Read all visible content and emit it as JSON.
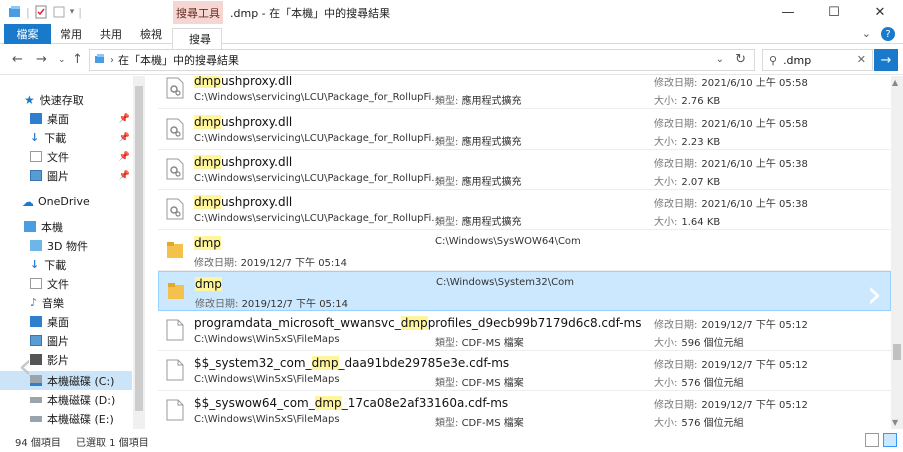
{
  "title_bar": {
    "context_tab": "搜尋工具",
    "title": ".dmp - 在「本機」中的搜尋結果"
  },
  "ribbon": {
    "tabs": [
      "檔案",
      "常用",
      "共用",
      "檢視",
      "搜尋"
    ]
  },
  "address": {
    "path": "在「本機」中的搜尋結果",
    "search_value": ".dmp"
  },
  "nav": {
    "quick_access": "快速存取",
    "quick_items": [
      "桌面",
      "下載",
      "文件",
      "圖片"
    ],
    "onedrive": "OneDrive",
    "this_pc": "本機",
    "pc_items": [
      "3D 物件",
      "下載",
      "文件",
      "音樂",
      "桌面",
      "圖片",
      "影片",
      "本機磁碟 (C:)",
      "本機磁碟 (D:)",
      "本機磁碟 (E:)"
    ]
  },
  "files": [
    {
      "kind": "dll",
      "pre": "",
      "hl": "dmp",
      "post": "ushproxy.dll",
      "path": "C:\\Windows\\servicing\\LCU\\Package_for_RollupFi...",
      "type_label": "類型:",
      "type": "應用程式擴充",
      "mod_label": "修改日期:",
      "mod": "2021/6/10 上午 05:58",
      "size_label": "大小:",
      "size": "2.76 KB"
    },
    {
      "kind": "dll",
      "pre": "",
      "hl": "dmp",
      "post": "ushproxy.dll",
      "path": "C:\\Windows\\servicing\\LCU\\Package_for_RollupFi...",
      "type_label": "類型:",
      "type": "應用程式擴充",
      "mod_label": "修改日期:",
      "mod": "2021/6/10 上午 05:58",
      "size_label": "大小:",
      "size": "2.23 KB"
    },
    {
      "kind": "dll",
      "pre": "",
      "hl": "dmp",
      "post": "ushproxy.dll",
      "path": "C:\\Windows\\servicing\\LCU\\Package_for_RollupFi...",
      "type_label": "類型:",
      "type": "應用程式擴充",
      "mod_label": "修改日期:",
      "mod": "2021/6/10 上午 05:38",
      "size_label": "大小:",
      "size": "2.07 KB"
    },
    {
      "kind": "dll",
      "pre": "",
      "hl": "dmp",
      "post": "ushproxy.dll",
      "path": "C:\\Windows\\servicing\\LCU\\Package_for_RollupFi...",
      "type_label": "類型:",
      "type": "應用程式擴充",
      "mod_label": "修改日期:",
      "mod": "2021/6/10 上午 05:38",
      "size_label": "大小:",
      "size": "1.64 KB"
    },
    {
      "kind": "folder",
      "pre": "",
      "hl": "dmp",
      "post": "",
      "location": "C:\\Windows\\SysWOW64\\Com",
      "mod_label": "修改日期:",
      "mod": "2019/12/7 下午 05:14"
    },
    {
      "kind": "folder",
      "pre": "",
      "hl": "dmp",
      "post": "",
      "location": "C:\\Windows\\System32\\Com",
      "mod_label": "修改日期:",
      "mod": "2019/12/7 下午 05:14",
      "selected": true
    },
    {
      "kind": "doc",
      "pre": "programdata_microsoft_wwansvc_",
      "hl": "dmp",
      "post": "profiles_d9ecb99b7179d6c8.cdf-ms",
      "path": "C:\\Windows\\WinSxS\\FileMaps",
      "type_label": "類型:",
      "type": "CDF-MS 檔案",
      "mod_label": "修改日期:",
      "mod": "2019/12/7 下午 05:12",
      "size_label": "大小:",
      "size": "596 個位元組"
    },
    {
      "kind": "doc",
      "pre": "$$_system32_com_",
      "hl": "dmp",
      "post": "_daa91bde29785e3e.cdf-ms",
      "path": "C:\\Windows\\WinSxS\\FileMaps",
      "type_label": "類型:",
      "type": "CDF-MS 檔案",
      "mod_label": "修改日期:",
      "mod": "2019/12/7 下午 05:12",
      "size_label": "大小:",
      "size": "576 個位元組"
    },
    {
      "kind": "doc",
      "pre": "$$_syswow64_com_",
      "hl": "dmp",
      "post": "_17ca08e2af33160a.cdf-ms",
      "path": "C:\\Windows\\WinSxS\\FileMaps",
      "type_label": "類型:",
      "type": "CDF-MS 檔案",
      "mod_label": "修改日期:",
      "mod": "2019/12/7 下午 05:12",
      "size_label": "大小:",
      "size": "576 個位元組"
    }
  ],
  "status": {
    "count": "94 個項目",
    "selected": "已選取 1 個項目"
  },
  "colors": {
    "accent": "#1979ca",
    "selection": "#cce8ff",
    "highlight": "#fff59d",
    "context_tab": "#f6d6d3"
  }
}
